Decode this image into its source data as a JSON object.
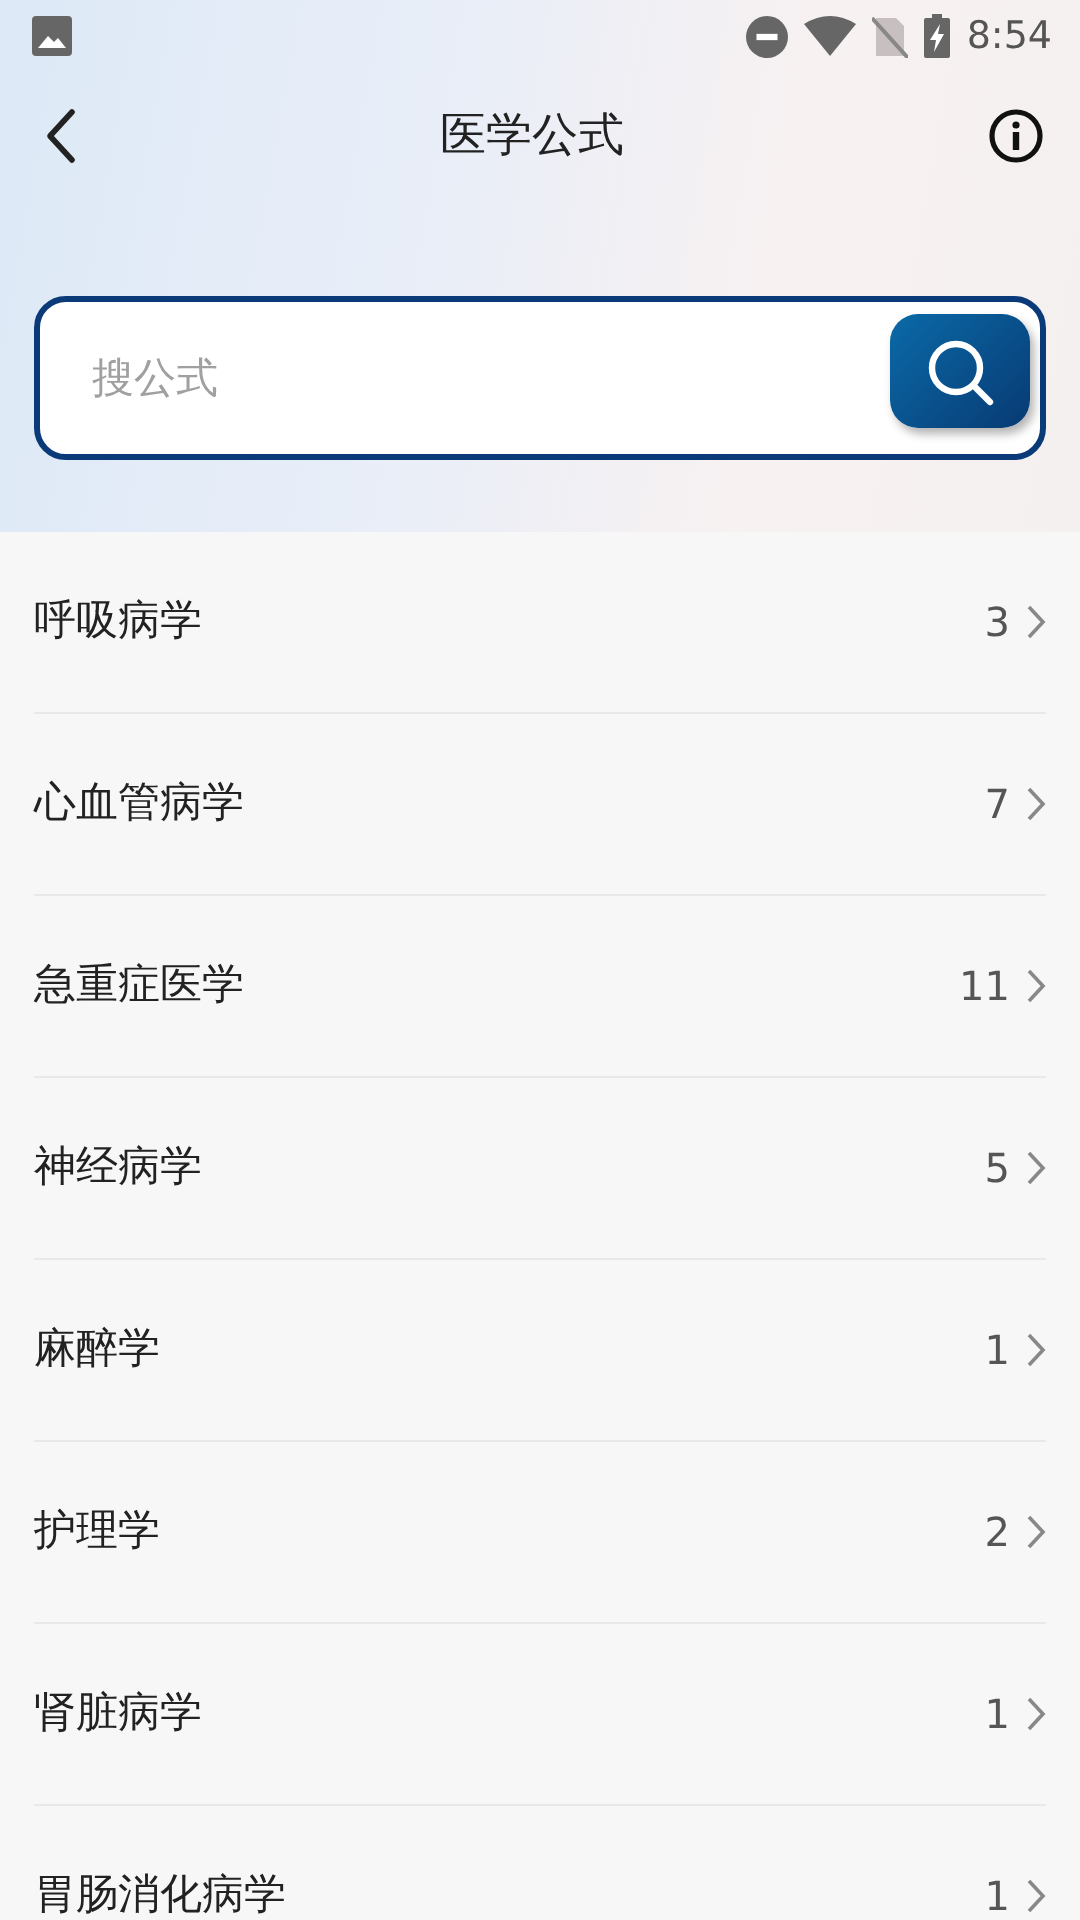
{
  "status_bar": {
    "time": "8:54"
  },
  "header": {
    "title": "医学公式"
  },
  "search": {
    "placeholder": "搜公式"
  },
  "categories": [
    {
      "name": "呼吸病学",
      "count": "3"
    },
    {
      "name": "心血管病学",
      "count": "7"
    },
    {
      "name": "急重症医学",
      "count": "11"
    },
    {
      "name": "神经病学",
      "count": "5"
    },
    {
      "name": "麻醉学",
      "count": "1"
    },
    {
      "name": "护理学",
      "count": "2"
    },
    {
      "name": "肾脏病学",
      "count": "1"
    },
    {
      "name": "胃肠消化病学",
      "count": "1"
    }
  ]
}
